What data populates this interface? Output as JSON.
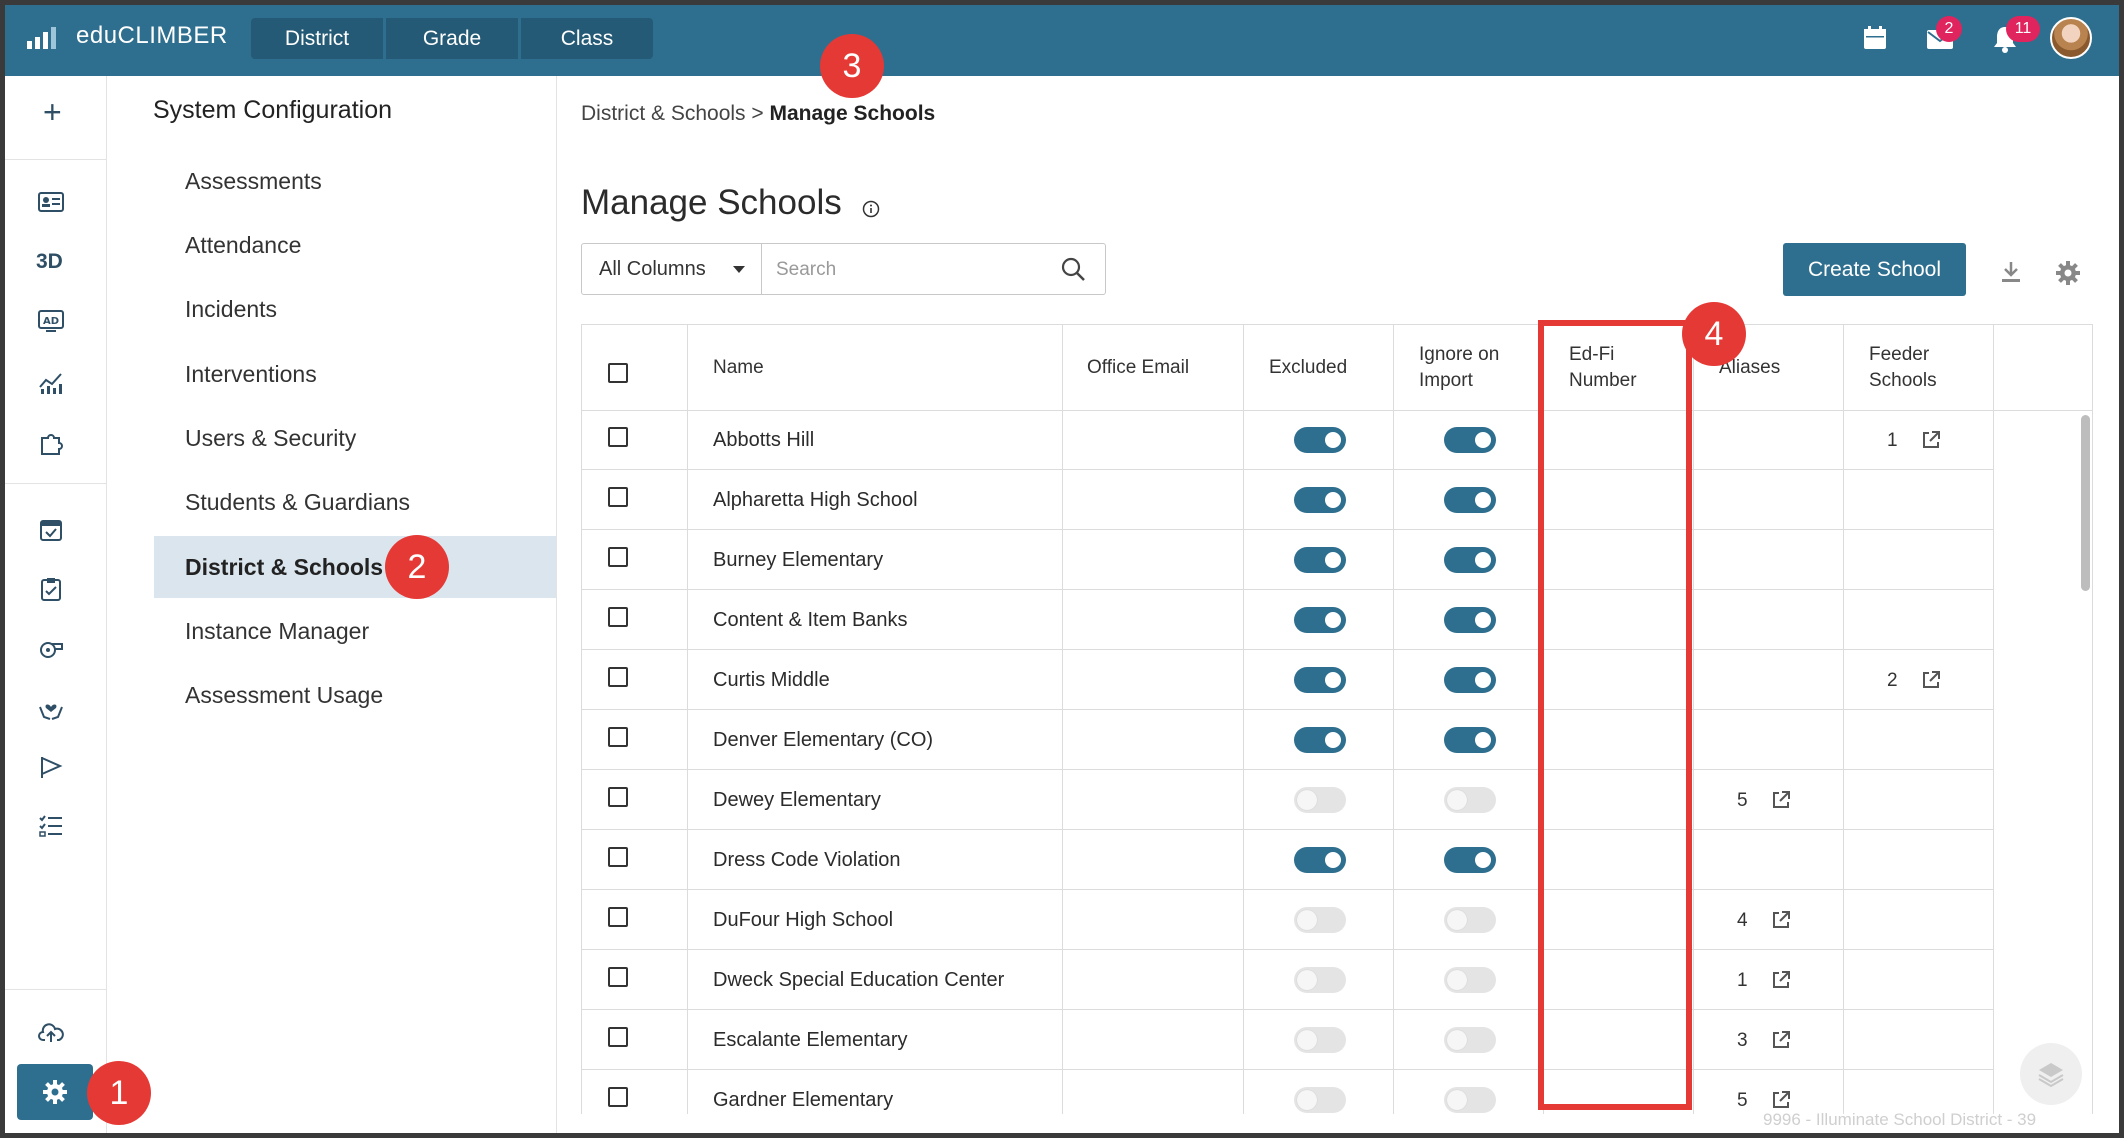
{
  "app": {
    "name": "eduCLIMBER"
  },
  "topnav": {
    "segments": [
      "District",
      "Grade",
      "Class"
    ],
    "mail_badge": "2",
    "notif_badge": "11"
  },
  "sidebar": {
    "title": "System Configuration",
    "items": [
      "Assessments",
      "Attendance",
      "Incidents",
      "Interventions",
      "Users & Security",
      "Students & Guardians",
      "District & Schools",
      "Instance Manager",
      "Assessment Usage"
    ],
    "active": "District & Schools"
  },
  "breadcrumb": {
    "parent": "District & Schools",
    "separator": ">",
    "current": "Manage Schools"
  },
  "page": {
    "title": "Manage Schools"
  },
  "filter": {
    "column_select": "All Columns",
    "search_placeholder": "Search"
  },
  "actions": {
    "create": "Create School"
  },
  "table": {
    "headers": {
      "name": "Name",
      "office_email": "Office Email",
      "excluded": "Excluded",
      "ignore_on_import_1": "Ignore on",
      "ignore_on_import_2": "Import",
      "edfi_1": "Ed-Fi",
      "edfi_2": "Number",
      "aliases": "Aliases",
      "feeder_1": "Feeder",
      "feeder_2": "Schools"
    },
    "rows": [
      {
        "name": "Abbotts Hill",
        "excluded": true,
        "ignore": true,
        "aliases": "",
        "feeder": "1"
      },
      {
        "name": "Alpharetta High School",
        "excluded": true,
        "ignore": true,
        "aliases": "",
        "feeder": ""
      },
      {
        "name": "Burney Elementary",
        "excluded": true,
        "ignore": true,
        "aliases": "",
        "feeder": ""
      },
      {
        "name": "Content & Item Banks",
        "excluded": true,
        "ignore": true,
        "aliases": "",
        "feeder": ""
      },
      {
        "name": "Curtis Middle",
        "excluded": true,
        "ignore": true,
        "aliases": "",
        "feeder": "2"
      },
      {
        "name": "Denver Elementary (CO)",
        "excluded": true,
        "ignore": true,
        "aliases": "",
        "feeder": ""
      },
      {
        "name": "Dewey Elementary",
        "excluded": false,
        "ignore": false,
        "aliases": "5",
        "feeder": ""
      },
      {
        "name": "Dress Code Violation",
        "excluded": true,
        "ignore": true,
        "aliases": "",
        "feeder": ""
      },
      {
        "name": "DuFour High School",
        "excluded": false,
        "ignore": false,
        "aliases": "4",
        "feeder": ""
      },
      {
        "name": "Dweck Special Education Center",
        "excluded": false,
        "ignore": false,
        "aliases": "1",
        "feeder": ""
      },
      {
        "name": "Escalante Elementary",
        "excluded": false,
        "ignore": false,
        "aliases": "3",
        "feeder": ""
      },
      {
        "name": "Gardner Elementary",
        "excluded": false,
        "ignore": false,
        "aliases": "5",
        "feeder": ""
      }
    ]
  },
  "annotations": [
    "1",
    "2",
    "3",
    "4"
  ],
  "footer": {
    "text": "9996 - Illuminate School District - 39"
  },
  "colors": {
    "brand": "#2e6f8f",
    "brand_dark": "#245a75",
    "marker": "#e53935",
    "badge": "#e0245e"
  },
  "icons": [
    "logo-bars-icon",
    "calendar-icon",
    "mail-icon",
    "bell-icon",
    "plus-icon",
    "id-card-icon",
    "ad-icon",
    "chart-icon",
    "puzzle-icon",
    "calendar-check-icon",
    "clipboard-icon",
    "whistle-icon",
    "heart-hands-icon",
    "flag-icon",
    "checklist-icon",
    "cloud-upload-icon",
    "gear-icon",
    "info-icon",
    "caret-down-icon",
    "search-icon",
    "download-icon",
    "external-link-icon",
    "layers-icon"
  ]
}
